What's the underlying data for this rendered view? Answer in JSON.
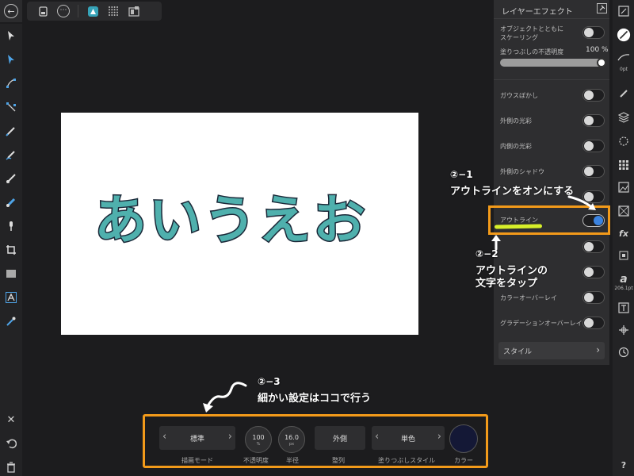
{
  "top_bar": {
    "back_icon": "←",
    "toolbar_icons": [
      "document-icon",
      "more-icon",
      "persona-icon",
      "grid-icon",
      "export-icon"
    ],
    "more_glyph": "⋯"
  },
  "left_tools": [
    "move-tool",
    "node-tool",
    "pen-tool",
    "crop-tool",
    "pencil-tool",
    "brush-tool",
    "fill-tool",
    "gradient-tool",
    "smudge-tool",
    "transform-tool",
    "rectangle-tool",
    "text-tool",
    "eyedropper-tool"
  ],
  "left_bottom": {
    "close": "✕",
    "undo": "↶",
    "trash": "🗑"
  },
  "canvas": {
    "text": "あいうえお",
    "fill_color": "#4fb0ad",
    "stroke_color": "#1b2838"
  },
  "panel": {
    "title": "レイヤーエフェクト",
    "scale_with_object": "オブジェクトとともに\nスケーリング",
    "fill_opacity_label": "塗りつぶしの不透明度",
    "fill_opacity_value": "100 %",
    "effects": [
      {
        "label": "ガウスぼかし",
        "on": false
      },
      {
        "label": "外側の光彩",
        "on": false
      },
      {
        "label": "内側の光彩",
        "on": false
      },
      {
        "label": "外側のシャドウ",
        "on": false
      },
      {
        "label": "",
        "on": false
      },
      {
        "label": "アウトライン",
        "on": true
      },
      {
        "label": "",
        "on": false
      },
      {
        "label": "",
        "on": false
      },
      {
        "label": "カラーオーバーレイ",
        "on": false
      },
      {
        "label": "グラデーションオーバーレイ",
        "on": false
      }
    ],
    "style_label": "スタイル",
    "chevron": "›"
  },
  "right_strip": {
    "size_label": "0pt",
    "font_size": "206.1pt",
    "fx": "fx",
    "help": "?"
  },
  "context_bar": {
    "draw_mode_value": "標準",
    "draw_mode_label": "描画モード",
    "opacity_value": "100",
    "opacity_unit": "%",
    "opacity_label": "不透明度",
    "radius_value": "16.0",
    "radius_unit": "px",
    "radius_label": "半径",
    "align_value": "外側",
    "align_label": "整列",
    "fill_style_value": "単色",
    "fill_style_label": "塗りつぶしスタイル",
    "color_label": "カラー",
    "color": "#141836"
  },
  "annotations": {
    "a1_num": "②−1",
    "a1_text": "アウトラインをオンにする",
    "a2_num": "②−2",
    "a2_line1": "アウトラインの",
    "a2_line2": "文字をタップ",
    "a3_num": "②−3",
    "a3_text": "細かい設定はココで行う",
    "accent": "#f29a1a",
    "marker": "#d7ef2a"
  }
}
